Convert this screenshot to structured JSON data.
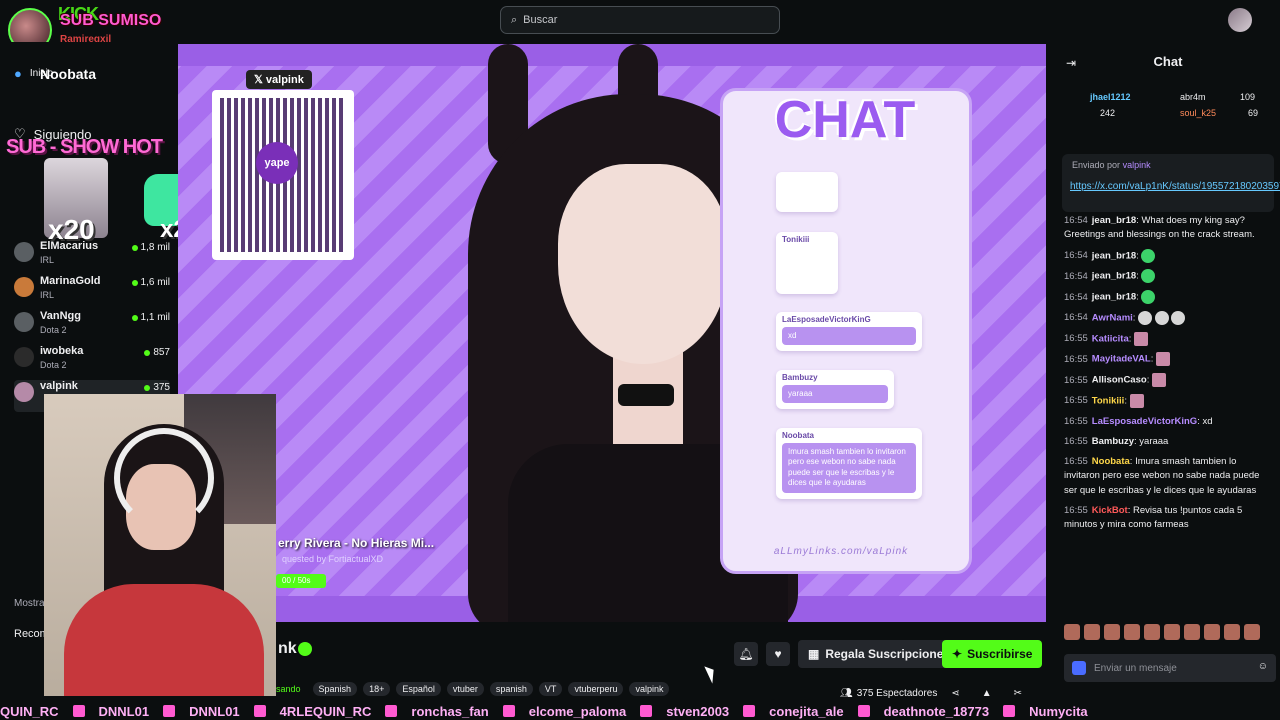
{
  "search": {
    "placeholder": "Buscar"
  },
  "overlay": {
    "kick": "KICK",
    "sub_label": "SUB SUMISO",
    "sub_user": "Ramireqxil",
    "donor": "Noobata",
    "show_hot": "SUB - SHOW HOT",
    "x20": "x20",
    "x2": "x2"
  },
  "nav": {
    "inicio": "Inicio",
    "siguiendo": "Siguiendo"
  },
  "channels": [
    {
      "name": "ElMacarius",
      "cat": "IRL",
      "viewers": "1,8 mil"
    },
    {
      "name": "MarinaGold",
      "cat": "IRL",
      "viewers": "1,6 mil"
    },
    {
      "name": "VanNgg",
      "cat": "Dota 2",
      "viewers": "1,1 mil"
    },
    {
      "name": "iwobeka",
      "cat": "Dota 2",
      "viewers": "857"
    },
    {
      "name": "valpink",
      "cat": "",
      "viewers": "375"
    }
  ],
  "sidebar_labels": {
    "mostrar": "Mostrar",
    "recom": "Recom"
  },
  "stream": {
    "x_handle": "valpink",
    "qr_label": "yape",
    "chat_title": "CHAT",
    "cards": [
      {
        "who": "",
        "msg": ""
      },
      {
        "who": "Tonikiii",
        "msg": ""
      },
      {
        "who": "LaEsposadeVictorKinG",
        "msg": "xd"
      },
      {
        "who": "Bambuzy",
        "msg": "yaraaa"
      },
      {
        "who": "Noobata",
        "msg": "Imura smash tambien lo invitaron pero ese webon no sabe nada puede ser que le escribas y le dices que le ayudaras"
      }
    ],
    "links": "aLLmyLinks.com/vaLpink",
    "song": "erry Rivera - No Hieras Mi...",
    "song_req": "quested by FortiactualXD",
    "song_bar": "00 / 50s"
  },
  "under": {
    "channel_name": "nk",
    "gift_label": "Regala Suscripciones",
    "sub_label": "Suscribirse",
    "tags": [
      "sando",
      "Spanish",
      "18+",
      "Español",
      "vtuber",
      "spanish",
      "VT",
      "vtuberperu",
      "valpink"
    ],
    "viewers": "375 Espectadores"
  },
  "chat": {
    "title": "Chat",
    "leaders": [
      {
        "name": "jhael1212",
        "value": "242"
      },
      {
        "name": "abr4m",
        "value": "109"
      },
      {
        "name": "soul_k25",
        "value": "69"
      }
    ],
    "pinned_by": "Enviado por",
    "pinned_user": "valpink",
    "pinned_link": "https://x.com/vaLp1nK/status/1955721802035970318",
    "messages": [
      {
        "t": "16:54",
        "u": "jean_br18",
        "m": "What does my king say? Greetings and blessings on the crack stream.",
        "c": "#efeff1"
      },
      {
        "t": "16:54",
        "u": "jean_br18",
        "m": "",
        "c": "#efeff1"
      },
      {
        "t": "16:54",
        "u": "jean_br18",
        "m": "",
        "c": "#efeff1"
      },
      {
        "t": "16:54",
        "u": "jean_br18",
        "m": "",
        "c": "#efeff1"
      },
      {
        "t": "16:54",
        "u": "AwrNami",
        "m": "",
        "c": "#b68cff"
      },
      {
        "t": "16:55",
        "u": "Katiicita",
        "m": "",
        "c": "#b68cff"
      },
      {
        "t": "16:55",
        "u": "MayitadeVAL",
        "m": "",
        "c": "#b68cff"
      },
      {
        "t": "16:55",
        "u": "AllisonCaso",
        "m": "",
        "c": "#efeff1"
      },
      {
        "t": "16:55",
        "u": "Tonikiii",
        "m": "",
        "c": "#ffd84a"
      },
      {
        "t": "16:55",
        "u": "LaEsposadeVictorKinG",
        "m": "xd",
        "c": "#b68cff"
      },
      {
        "t": "16:55",
        "u": "Bambuzy",
        "m": "yaraaa",
        "c": "#efeff1"
      },
      {
        "t": "16:55",
        "u": "Noobata",
        "m": "Imura smash tambien lo invitaron pero ese webon no sabe nada puede ser que le escribas y le dices que le ayudaras",
        "c": "#ffd84a"
      },
      {
        "t": "16:55",
        "u": "KickBot",
        "m": "Revisa tus !puntos cada 5 minutos y mira como farmeas",
        "c": "#ff5a5a"
      }
    ],
    "input_placeholder": "Enviar un mensaje"
  },
  "ticker": [
    "QUIN_RC",
    "DNNL01",
    "DNNL01",
    "4RLEQUIN_RC",
    "ronchas_fan",
    "elcome_paloma",
    "stven2003",
    "conejita_ale",
    "deathnote_18773",
    "Numycita"
  ]
}
